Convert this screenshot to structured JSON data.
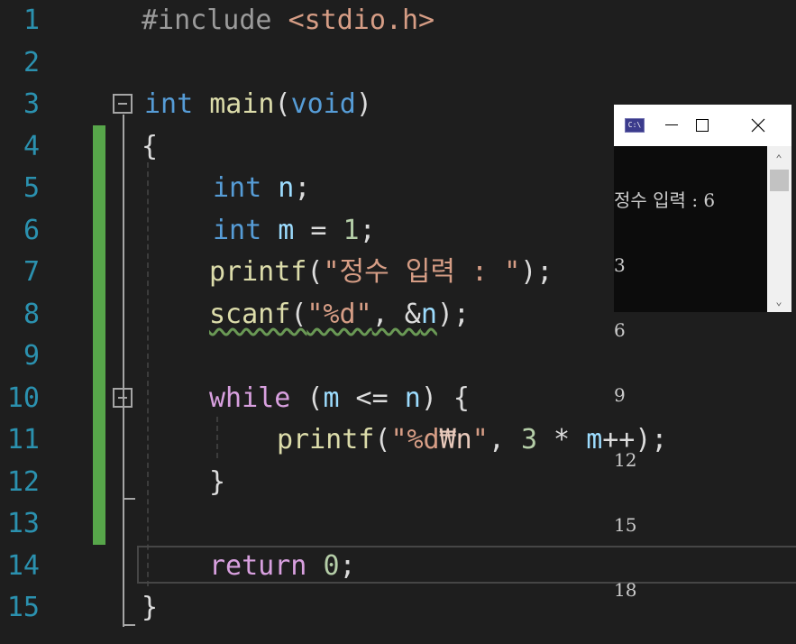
{
  "editor": {
    "line_numbers": [
      "1",
      "2",
      "3",
      "4",
      "5",
      "6",
      "7",
      "8",
      "9",
      "10",
      "11",
      "12",
      "13",
      "14",
      "15"
    ],
    "l1": {
      "directive": "#include",
      "header": "<stdio.h>"
    },
    "l3": {
      "kw": "int",
      "fn": "main",
      "open": "(",
      "param": "void",
      "close": ")"
    },
    "l4": "{",
    "l5": {
      "kw": "int",
      "var": "n",
      "tail": ";"
    },
    "l6": {
      "kw": "int",
      "var": "m",
      "eq": " = ",
      "num": "1",
      "tail": ";"
    },
    "l7": {
      "fn": "printf",
      "open": "(",
      "str": "\"정수 입력 : \"",
      "close": ");"
    },
    "l8": {
      "fn": "scanf",
      "open": "(",
      "str": "\"%d\"",
      "mid": ", &",
      "var": "n",
      "close": ");"
    },
    "l10": {
      "kw": "while",
      "open": " (",
      "var1": "m",
      "op": " <= ",
      "var2": "n",
      "close": ") {"
    },
    "l11": {
      "fn": "printf",
      "open": "(",
      "str1": "\"%d",
      "esc": "₩n",
      "str2": "\"",
      "mid": ", ",
      "num": "3",
      "op": " * ",
      "var": "m",
      "close": "++);"
    },
    "l12": "}",
    "l14": {
      "kw": "return",
      "num": "0",
      "tail": ";"
    },
    "l15": "}"
  },
  "console": {
    "icon_label": "C:\\",
    "icon": "console-app-icon",
    "output_lines": [
      "정수 입력 : 6",
      "3",
      "6",
      "9",
      "12",
      "15",
      "18"
    ]
  }
}
